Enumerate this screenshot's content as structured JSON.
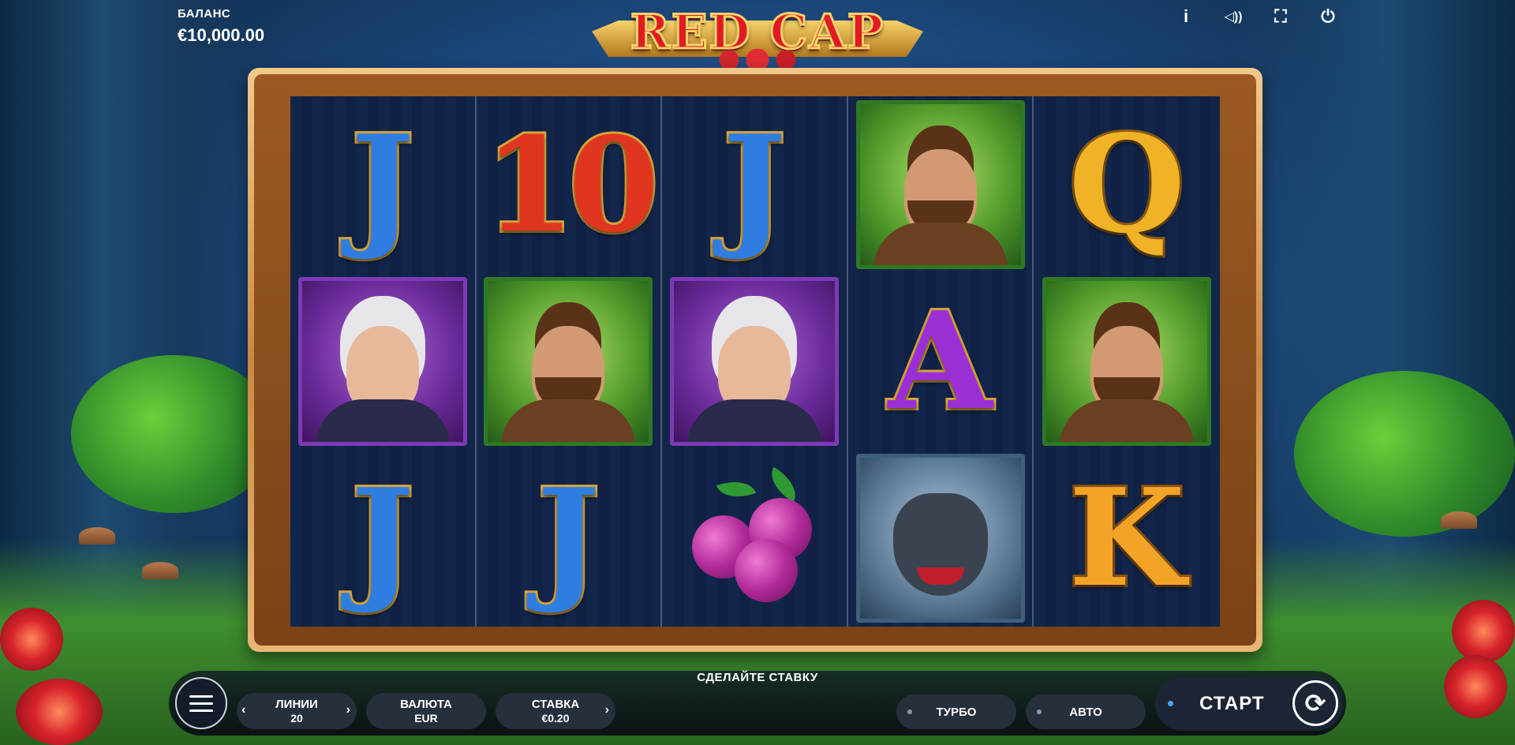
{
  "balance": {
    "label": "БАЛАНС",
    "value": "€10,000.00"
  },
  "logo": {
    "text": "RED CAP"
  },
  "top_icons": [
    "info-icon",
    "sound-icon",
    "fullscreen-icon",
    "power-icon"
  ],
  "top_icon_glyphs": {
    "info": "i",
    "sound": "◁))",
    "fullscreen": "⛶",
    "power": "⏻"
  },
  "reels": [
    [
      "J",
      "granny",
      "J"
    ],
    [
      "10",
      "hunter",
      "J"
    ],
    [
      "J",
      "granny",
      "berries"
    ],
    [
      "hunter",
      "A",
      "wolf"
    ],
    [
      "Q",
      "hunter",
      "K"
    ]
  ],
  "hint": "СДЕЛАЙТЕ СТАВКУ",
  "controls": {
    "lines": {
      "label": "ЛИНИИ",
      "value": "20"
    },
    "currency": {
      "label": "ВАЛЮТА",
      "value": "EUR"
    },
    "bet": {
      "label": "СТАВКА",
      "value": "€0.20"
    },
    "turbo": "ТУРБО",
    "auto": "АВТО",
    "start": "СТАРТ"
  },
  "glyphs": {
    "left_arrow": "‹",
    "right_arrow": "›",
    "spin": "⟳"
  },
  "colors": {
    "accent_blue": "#4fa3ff",
    "logo_red": "#e01b24",
    "frame_gold": "#c98842"
  }
}
